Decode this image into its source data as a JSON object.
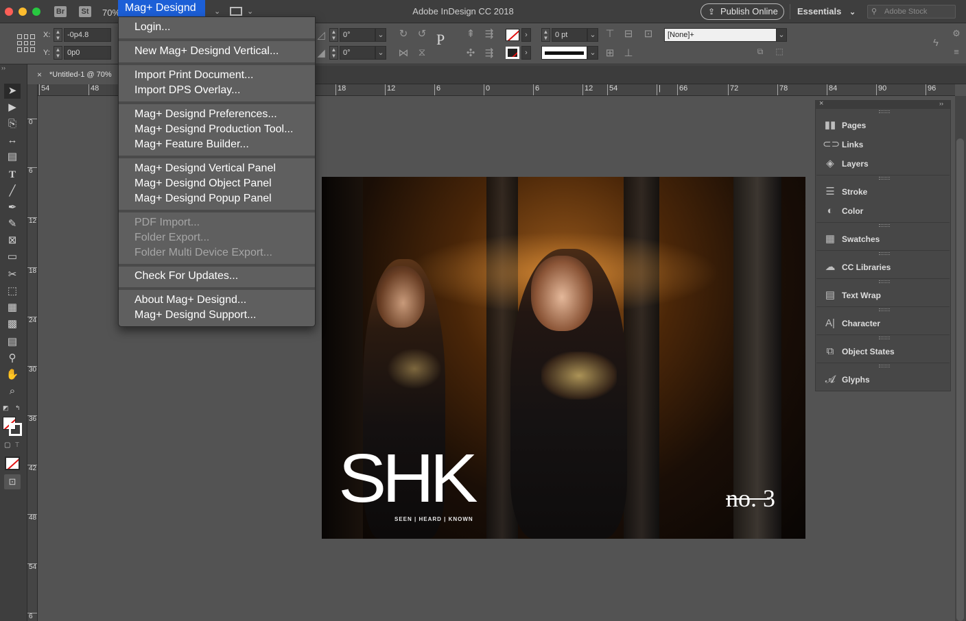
{
  "titlebar": {
    "bridge_badge": "Br",
    "stock_badge": "St",
    "zoom": "70%",
    "active_menu": "Mag+ Designd",
    "app_title": "Adobe InDesign CC 2018",
    "publish_label": "Publish Online",
    "workspace_label": "Essentials",
    "stock_placeholder": "Adobe Stock"
  },
  "control": {
    "x_label": "X:",
    "x_value": "-0p4.8",
    "y_label": "Y:",
    "y_value": "0p0",
    "rotate_value": "0°",
    "shear_value": "0°",
    "stroke_weight": "0 pt",
    "object_style": "[None]+"
  },
  "document_tab": {
    "title": "*Untitled-1 @ 70%",
    "close": "×"
  },
  "ruler": {
    "h_ticks": [
      "54",
      "48",
      "18",
      "12",
      "6",
      "0",
      "6",
      "12",
      "54",
      "|",
      "66",
      "72",
      "78",
      "84",
      "90",
      "96"
    ],
    "v_ticks": [
      "0",
      "6",
      "12",
      "18",
      "24",
      "30",
      "36",
      "42",
      "48",
      "54",
      "6"
    ]
  },
  "menu": {
    "groups": [
      [
        "Login..."
      ],
      [
        "New Mag+ Designd Vertical..."
      ],
      [
        "Import Print Document...",
        "Import DPS Overlay..."
      ],
      [
        "Mag+ Designd Preferences...",
        "Mag+ Designd Production Tool...",
        "Mag+ Feature Builder..."
      ],
      [
        "Mag+ Designd Vertical Panel",
        "Mag+ Designd Object Panel",
        "Mag+ Designd Popup Panel"
      ],
      [
        "PDF Import...",
        "Folder Export...",
        "Folder Multi Device Export..."
      ],
      [
        "Check For Updates..."
      ],
      [
        "About Mag+ Designd...",
        "Mag+ Designd Support..."
      ]
    ],
    "disabled_group": 5
  },
  "panels": {
    "items": [
      {
        "label": "Pages",
        "icon": "pages-icon"
      },
      {
        "label": "Links",
        "icon": "links-icon"
      },
      {
        "label": "Layers",
        "icon": "layers-icon"
      },
      {
        "label": "Stroke",
        "icon": "stroke-icon"
      },
      {
        "label": "Color",
        "icon": "color-icon"
      },
      {
        "label": "Swatches",
        "icon": "swatches-icon"
      },
      {
        "label": "CC Libraries",
        "icon": "cc-libraries-icon"
      },
      {
        "label": "Text Wrap",
        "icon": "text-wrap-icon"
      },
      {
        "label": "Character",
        "icon": "character-icon"
      },
      {
        "label": "Object States",
        "icon": "object-states-icon"
      },
      {
        "label": "Glyphs",
        "icon": "glyphs-icon"
      }
    ]
  },
  "artwork": {
    "logo": "SHK",
    "tagline": "SEEN | HEARD | KNOWN",
    "issue": "no. 3"
  },
  "colors": {
    "menu_highlight": "#1c5fd7",
    "app_bg": "#535353"
  }
}
